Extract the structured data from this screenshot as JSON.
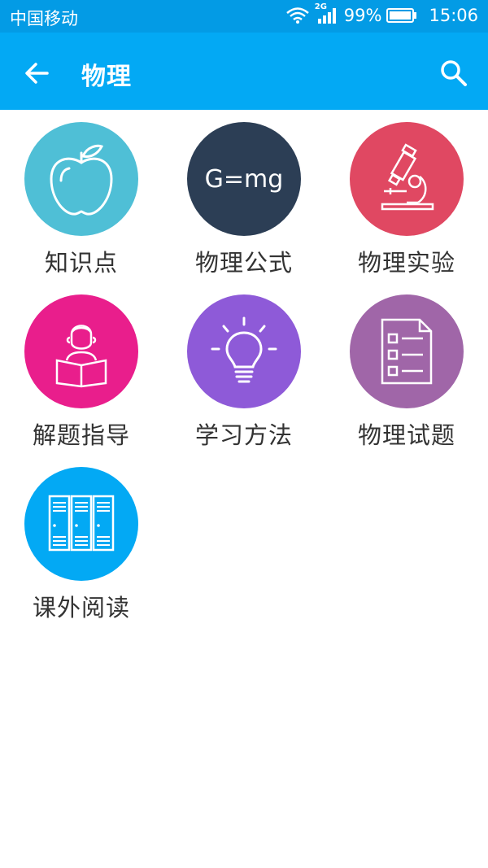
{
  "status_bar": {
    "carrier": "中国移动",
    "network": "2G",
    "battery": "99%",
    "time": "15:06"
  },
  "app_bar": {
    "title": "物理",
    "back_icon": "arrow-left-icon",
    "search_icon": "search-icon"
  },
  "tiles": [
    {
      "label": "知识点",
      "icon": "apple-icon",
      "color": "#4fbfd6"
    },
    {
      "label": "物理公式",
      "icon": "formula-icon",
      "formula": "G=mg",
      "color": "#2c3e55"
    },
    {
      "label": "物理实验",
      "icon": "microscope-icon",
      "color": "#e04862"
    },
    {
      "label": "解题指导",
      "icon": "reading-person-icon",
      "color": "#e91e8c"
    },
    {
      "label": "学习方法",
      "icon": "lightbulb-icon",
      "color": "#8e5ad8"
    },
    {
      "label": "物理试题",
      "icon": "checklist-icon",
      "color": "#a066a8"
    },
    {
      "label": "课外阅读",
      "icon": "bookshelf-icon",
      "color": "#03a9f4"
    }
  ],
  "colors": {
    "status_bar": "#039be5",
    "app_bar": "#03a9f4"
  }
}
